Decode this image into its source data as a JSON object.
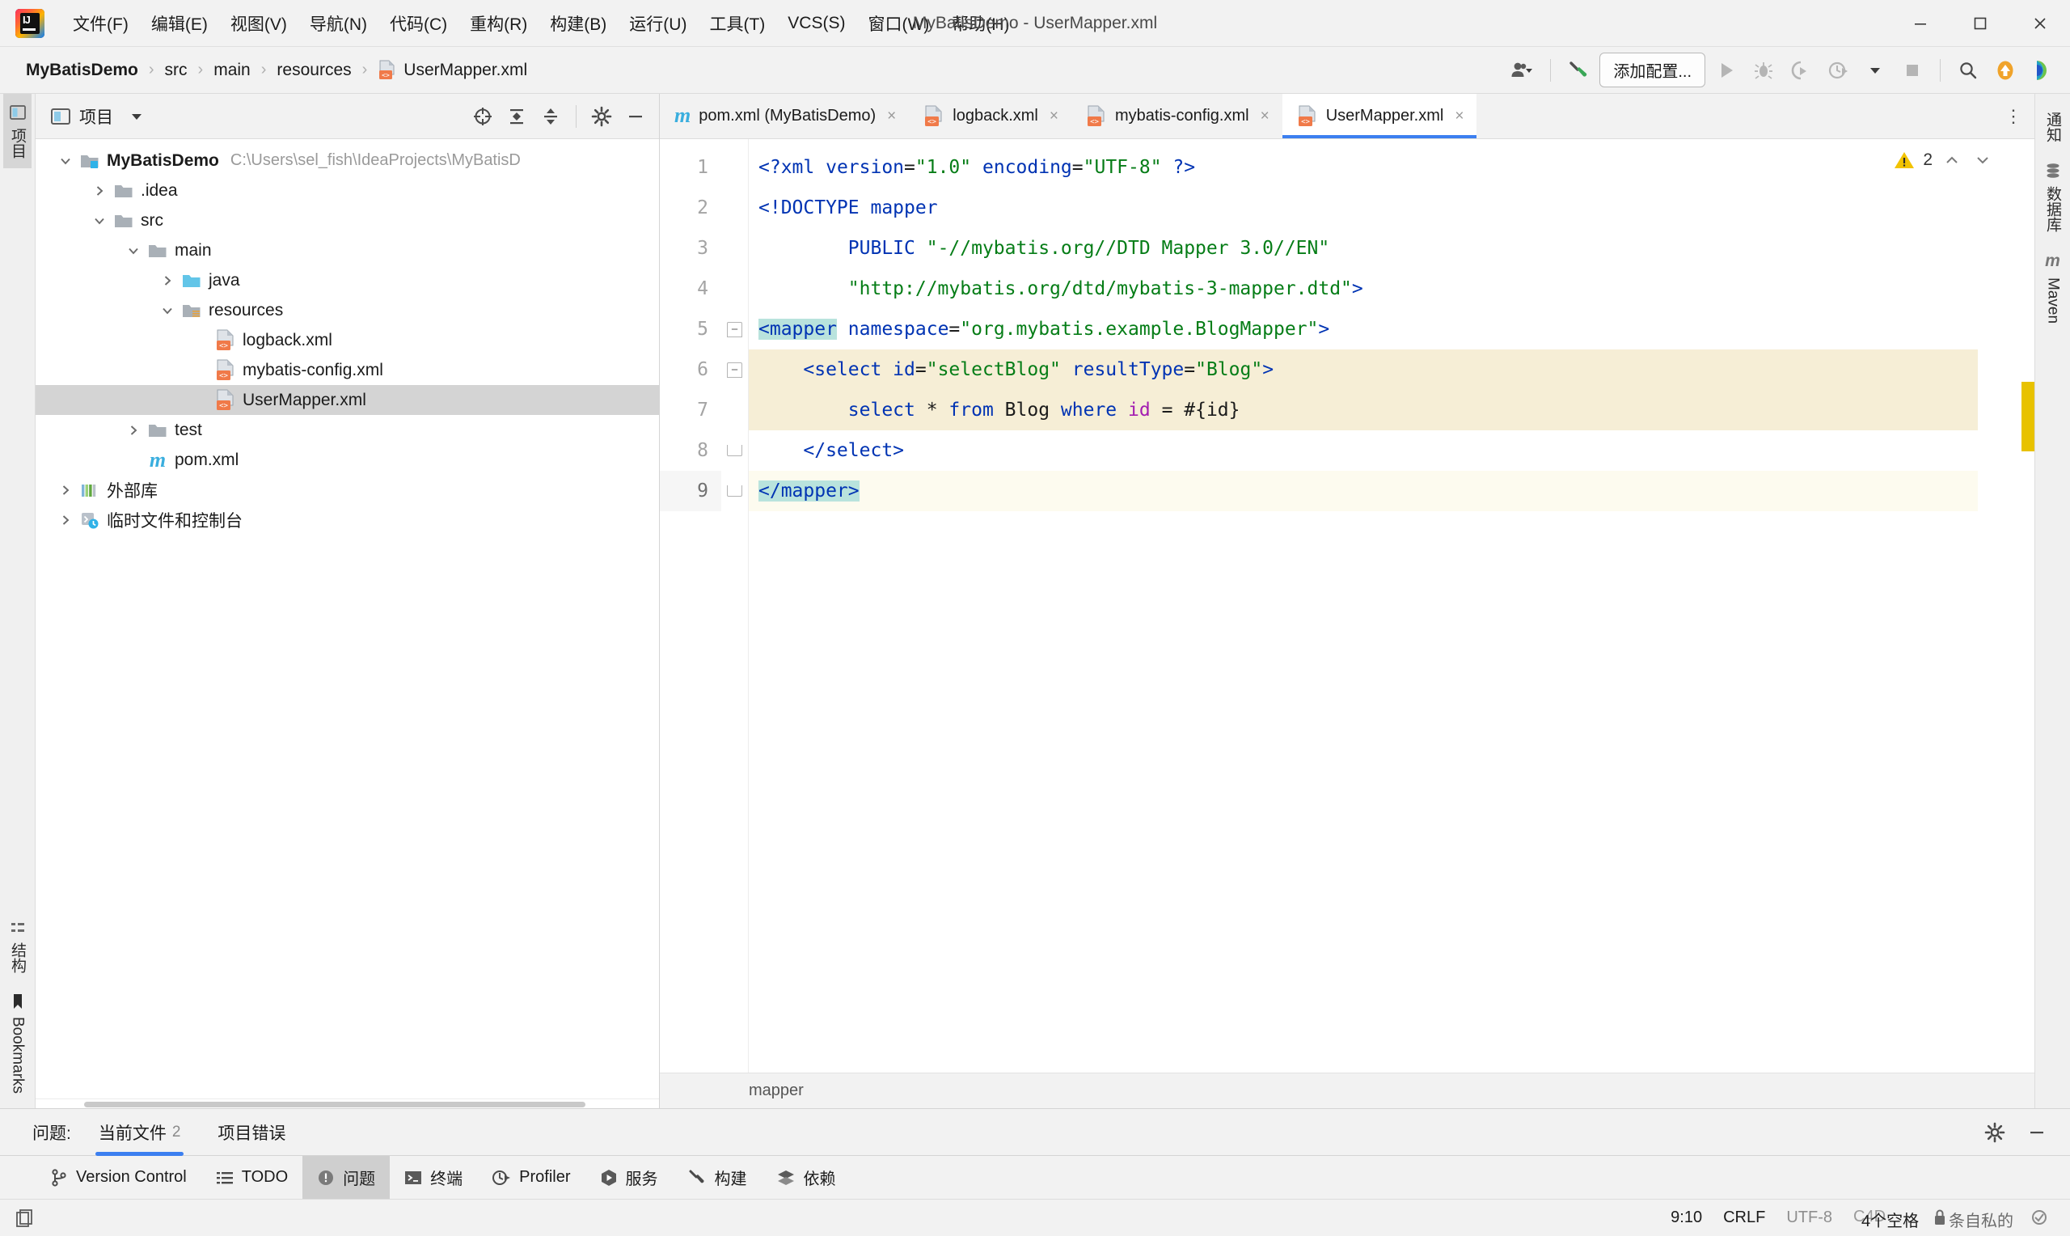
{
  "window": {
    "title": "MyBatisDemo - UserMapper.xml",
    "minimize_icon": "minimize-icon",
    "maximize_icon": "maximize-icon",
    "close_icon": "close-icon"
  },
  "menubar": {
    "logo_name": "intellij-idea-logo",
    "items": [
      {
        "label": "文件(F)"
      },
      {
        "label": "编辑(E)"
      },
      {
        "label": "视图(V)"
      },
      {
        "label": "导航(N)"
      },
      {
        "label": "代码(C)"
      },
      {
        "label": "重构(R)"
      },
      {
        "label": "构建(B)"
      },
      {
        "label": "运行(U)"
      },
      {
        "label": "工具(T)"
      },
      {
        "label": "VCS(S)"
      },
      {
        "label": "窗口(W)"
      },
      {
        "label": "帮助(H)"
      }
    ]
  },
  "toolbar": {
    "breadcrumbs": [
      {
        "label": "MyBatisDemo",
        "bold": true
      },
      {
        "label": "src",
        "bold": false
      },
      {
        "label": "main",
        "bold": false
      },
      {
        "label": "resources",
        "bold": false
      },
      {
        "label": "UserMapper.xml",
        "bold": false,
        "icon": "xml-file-icon"
      }
    ],
    "separator": "›",
    "account_icon": "user-account-icon",
    "build_icon": "hammer-build-icon",
    "add_config_label": "添加配置...",
    "run_icon": "run-icon",
    "debug_icon": "debug-icon",
    "run_with_coverage_icon": "run-coverage-icon",
    "profile_icon": "profiler-icon",
    "dropdown_icon": "chevron-down-icon",
    "stop_icon": "stop-icon",
    "search_icon": "search-icon",
    "update_icon": "update-arrow-icon",
    "ai_icon": "ai-assistant-icon"
  },
  "left_rail": {
    "tabs": [
      {
        "label": "项目",
        "icon": "project-icon",
        "selected": true
      },
      {
        "label": "结构",
        "icon": "structure-icon",
        "selected": false
      },
      {
        "label": "Bookmarks",
        "icon": "bookmark-icon",
        "selected": false
      }
    ]
  },
  "right_rail": {
    "tabs": [
      {
        "label": "通知",
        "icon": "notifications-icon"
      },
      {
        "label": "数据库",
        "icon": "database-icon"
      },
      {
        "label": "Maven",
        "icon": "maven-icon"
      }
    ]
  },
  "project_panel": {
    "title": "项目",
    "dropdown_icon": "chevron-down-icon",
    "actions": [
      {
        "name": "select-opened-file-icon",
        "glyph": "⊕"
      },
      {
        "name": "expand-all-icon",
        "glyph": "⤓"
      },
      {
        "name": "collapse-all-icon",
        "glyph": "⤒"
      },
      {
        "name": "settings-gear-icon",
        "glyph": "⚙"
      },
      {
        "name": "hide-panel-icon",
        "glyph": "—"
      }
    ],
    "tree": [
      {
        "label": "MyBatisDemo",
        "path": "C:\\Users\\sel_fish\\IdeaProjects\\MyBatisD",
        "depth": 0,
        "arrow": "expanded",
        "icon": "project-folder-icon",
        "bold": true,
        "selected": false
      },
      {
        "label": ".idea",
        "path": "",
        "depth": 1,
        "arrow": "collapsed",
        "icon": "folder-icon",
        "bold": false,
        "selected": false
      },
      {
        "label": "src",
        "path": "",
        "depth": 1,
        "arrow": "expanded",
        "icon": "folder-icon",
        "bold": false,
        "selected": false
      },
      {
        "label": "main",
        "path": "",
        "depth": 2,
        "arrow": "expanded",
        "icon": "folder-icon",
        "bold": false,
        "selected": false
      },
      {
        "label": "java",
        "path": "",
        "depth": 3,
        "arrow": "collapsed",
        "icon": "source-folder-icon",
        "bold": false,
        "selected": false
      },
      {
        "label": "resources",
        "path": "",
        "depth": 3,
        "arrow": "expanded",
        "icon": "resources-folder-icon",
        "bold": false,
        "selected": false
      },
      {
        "label": "logback.xml",
        "path": "",
        "depth": 4,
        "arrow": "none",
        "icon": "xml-file-icon",
        "bold": false,
        "selected": false
      },
      {
        "label": "mybatis-config.xml",
        "path": "",
        "depth": 4,
        "arrow": "none",
        "icon": "xml-file-icon",
        "bold": false,
        "selected": false
      },
      {
        "label": "UserMapper.xml",
        "path": "",
        "depth": 4,
        "arrow": "none",
        "icon": "xml-file-icon",
        "bold": false,
        "selected": true
      },
      {
        "label": "test",
        "path": "",
        "depth": 2,
        "arrow": "collapsed",
        "icon": "folder-icon",
        "bold": false,
        "selected": false
      },
      {
        "label": "pom.xml",
        "path": "",
        "depth": 2,
        "arrow": "none",
        "icon": "maven-pom-icon",
        "bold": false,
        "selected": false
      },
      {
        "label": "外部库",
        "path": "",
        "depth": 0,
        "arrow": "collapsed",
        "icon": "external-libraries-icon",
        "bold": false,
        "selected": false
      },
      {
        "label": "临时文件和控制台",
        "path": "",
        "depth": 0,
        "arrow": "collapsed",
        "icon": "scratches-icon",
        "bold": false,
        "selected": false
      }
    ]
  },
  "editor": {
    "tabs": [
      {
        "label": "pom.xml (MyBatisDemo)",
        "icon": "maven-pom-icon",
        "active": false
      },
      {
        "label": "logback.xml",
        "icon": "xml-file-icon",
        "active": false
      },
      {
        "label": "mybatis-config.xml",
        "icon": "xml-file-icon",
        "active": false
      },
      {
        "label": "UserMapper.xml",
        "icon": "xml-file-icon",
        "active": true
      }
    ],
    "close_glyph": "×",
    "more_glyph": "⋮",
    "line_numbers": [
      "1",
      "2",
      "3",
      "4",
      "5",
      "6",
      "7",
      "8",
      "9"
    ],
    "breadcrumb": "mapper",
    "inspection": {
      "warning_icon": "warning-triangle-icon",
      "warning_count": "2",
      "prev_icon": "chevron-up-icon",
      "next_icon": "chevron-down-icon"
    },
    "code_lines": [
      {
        "n": 1,
        "hl": "none",
        "tokens": [
          {
            "t": "<?xml ",
            "c": "tag"
          },
          {
            "t": "version",
            "c": "attr"
          },
          {
            "t": "=",
            "c": "txt"
          },
          {
            "t": "\"1.0\"",
            "c": "val"
          },
          {
            "t": " ",
            "c": "txt"
          },
          {
            "t": "encoding",
            "c": "attr"
          },
          {
            "t": "=",
            "c": "txt"
          },
          {
            "t": "\"UTF-8\"",
            "c": "val"
          },
          {
            "t": " ?>",
            "c": "tag"
          }
        ]
      },
      {
        "n": 2,
        "hl": "none",
        "tokens": [
          {
            "t": "<!DOCTYPE mapper",
            "c": "tag"
          }
        ]
      },
      {
        "n": 3,
        "hl": "none",
        "tokens": [
          {
            "t": "        PUBLIC ",
            "c": "tag"
          },
          {
            "t": "\"-//mybatis.org//DTD Mapper 3.0//EN\"",
            "c": "val"
          }
        ]
      },
      {
        "n": 4,
        "hl": "none",
        "tokens": [
          {
            "t": "        ",
            "c": "txt"
          },
          {
            "t": "\"http://mybatis.org/dtd/mybatis-3-mapper.dtd\"",
            "c": "val"
          },
          {
            "t": ">",
            "c": "tag"
          }
        ]
      },
      {
        "n": 5,
        "hl": "none",
        "tokens": [
          {
            "t": "<mapper",
            "c": "tag hlsel"
          },
          {
            "t": " ",
            "c": "txt"
          },
          {
            "t": "namespace",
            "c": "attr"
          },
          {
            "t": "=",
            "c": "txt"
          },
          {
            "t": "\"org.mybatis.example.BlogMapper\"",
            "c": "val"
          },
          {
            "t": ">",
            "c": "tag"
          }
        ]
      },
      {
        "n": 6,
        "hl": "warn",
        "tokens": [
          {
            "t": "    <select ",
            "c": "tag"
          },
          {
            "t": "id",
            "c": "attr"
          },
          {
            "t": "=",
            "c": "txt"
          },
          {
            "t": "\"selectBlog\"",
            "c": "val"
          },
          {
            "t": " ",
            "c": "txt"
          },
          {
            "t": "resultType",
            "c": "attr"
          },
          {
            "t": "=",
            "c": "txt"
          },
          {
            "t": "\"Blog\"",
            "c": "val"
          },
          {
            "t": ">",
            "c": "tag"
          }
        ]
      },
      {
        "n": 7,
        "hl": "warn",
        "tokens": [
          {
            "t": "        ",
            "c": "txt"
          },
          {
            "t": "select ",
            "c": "sqlkw"
          },
          {
            "t": "* ",
            "c": "txt"
          },
          {
            "t": "from ",
            "c": "sqlkw"
          },
          {
            "t": "Blog ",
            "c": "txt"
          },
          {
            "t": "where ",
            "c": "sqlkw"
          },
          {
            "t": "id",
            "c": "pink"
          },
          {
            "t": " = #{id}",
            "c": "txt"
          }
        ]
      },
      {
        "n": 8,
        "hl": "none",
        "tokens": [
          {
            "t": "    </select>",
            "c": "tag"
          }
        ]
      },
      {
        "n": 9,
        "hl": "cur",
        "tokens": [
          {
            "t": "</mapper>",
            "c": "tag hlsel"
          }
        ]
      }
    ]
  },
  "problems_panel": {
    "label": "问题:",
    "tabs": [
      {
        "label": "当前文件",
        "count": "2",
        "active": true
      },
      {
        "label": "项目错误",
        "count": "",
        "active": false
      }
    ],
    "settings_icon": "settings-gear-icon",
    "hide_icon": "hide-panel-icon"
  },
  "bottom_tabs": [
    {
      "label": "Version Control",
      "icon": "branch-icon",
      "active": false
    },
    {
      "label": "TODO",
      "icon": "todo-list-icon",
      "active": false
    },
    {
      "label": "问题",
      "icon": "problems-icon",
      "active": true
    },
    {
      "label": "终端",
      "icon": "terminal-icon",
      "active": false
    },
    {
      "label": "Profiler",
      "icon": "profiler-icon",
      "active": false
    },
    {
      "label": "服务",
      "icon": "services-icon",
      "active": false
    },
    {
      "label": "构建",
      "icon": "hammer-build-icon",
      "active": false
    },
    {
      "label": "依赖",
      "icon": "dependencies-icon",
      "active": false
    }
  ],
  "statusbar": {
    "left_icon": "open-files-icon",
    "caret_position": "9:10",
    "line_separator": "CRLF",
    "encoding": "UTF-8",
    "indent_overlap_back": "C4D",
    "indent": "4个空格",
    "read_only_icon": "lock-icon",
    "privacy_label": "条自私的",
    "extra_icon": "inspection-status-icon"
  },
  "colors": {
    "accent": "#3c7ff0",
    "tag": "#0033b3",
    "value": "#067d17",
    "selection": "#b9e3dd",
    "warn_highlight": "#f6eed6",
    "warn_yellow": "#e8c200",
    "chrome": "#f2f2f2"
  }
}
